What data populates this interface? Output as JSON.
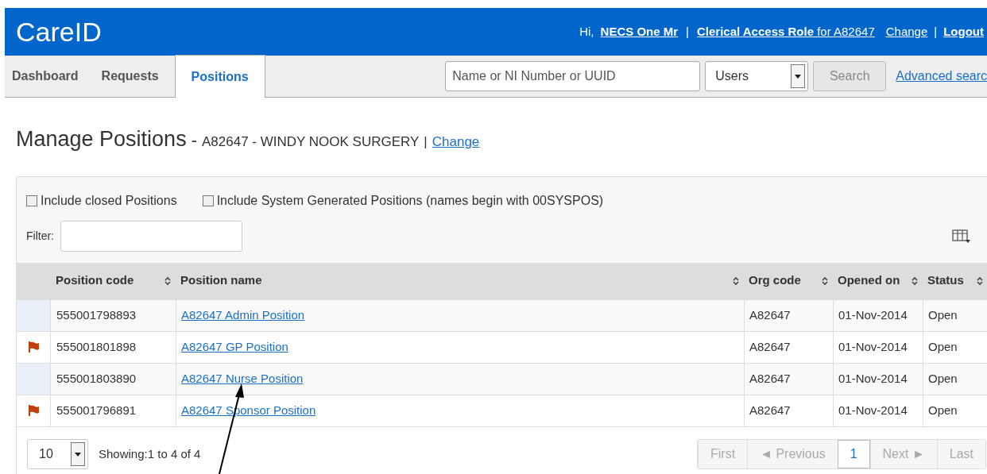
{
  "header": {
    "logo": "CareID",
    "greeting": "Hi,",
    "user_link": "NECS One Mr",
    "separator_1": "|",
    "role_link": "**Clerical Access Role** for A82647",
    "change_link": "Change",
    "separator_2": "|",
    "logout_link": "Logout"
  },
  "tabs": [
    {
      "label": "Dashboard",
      "selected": false
    },
    {
      "label": "Requests",
      "selected": false
    },
    {
      "label": "Positions",
      "selected": true
    }
  ],
  "search": {
    "placeholder": "Name or NI Number or UUID",
    "type_select": "Users",
    "button": "Search",
    "advanced_link": "Advanced searc"
  },
  "page_title": {
    "title": "Manage Positions",
    "dash": "-",
    "org": "A82647 - WINDY NOOK SURGERY",
    "separator": "|",
    "change_link": "Change"
  },
  "options": [
    {
      "label": "Include closed Positions",
      "checked": false
    },
    {
      "label": "Include System Generated Positions (names begin with 00SYSPOS)",
      "checked": false
    }
  ],
  "filter": {
    "label": "Filter:"
  },
  "table": {
    "columns": [
      "Position code",
      "Position name",
      "Org code",
      "Opened on",
      "Status"
    ],
    "rows": [
      {
        "flagged": false,
        "code": "555001798893",
        "name": "A82647 Admin Position",
        "org": "A82647",
        "opened": "01-Nov-2014",
        "status": "Open"
      },
      {
        "flagged": true,
        "code": "555001801898",
        "name": "A82647 GP Position",
        "org": "A82647",
        "opened": "01-Nov-2014",
        "status": "Open"
      },
      {
        "flagged": false,
        "code": "555001803890",
        "name": "A82647 Nurse Position",
        "org": "A82647",
        "opened": "01-Nov-2014",
        "status": "Open"
      },
      {
        "flagged": true,
        "code": "555001796891",
        "name": "A82647 Sponsor Position",
        "org": "A82647",
        "opened": "01-Nov-2014",
        "status": "Open"
      }
    ]
  },
  "footer": {
    "page_size": "10",
    "showing": "Showing:1 to 4 of 4",
    "pager": [
      {
        "label": "First",
        "disabled": true,
        "selected": false
      },
      {
        "label": "◄ Previous",
        "disabled": true,
        "selected": false
      },
      {
        "label": "1",
        "disabled": false,
        "selected": true
      },
      {
        "label": "Next ►",
        "disabled": true,
        "selected": false
      },
      {
        "label": "Last",
        "disabled": true,
        "selected": false
      }
    ]
  }
}
